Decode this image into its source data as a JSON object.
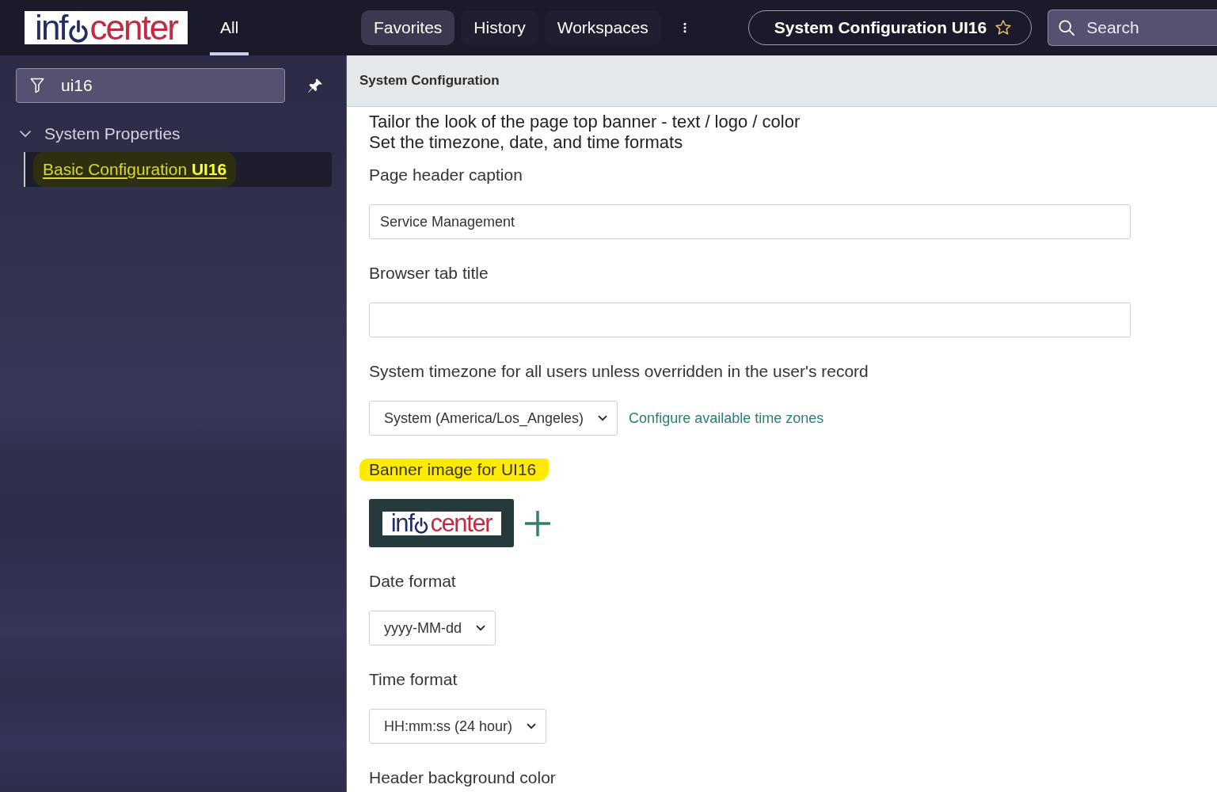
{
  "sidebar": {
    "logo": {
      "text_start": "inf",
      "text_end": "center"
    },
    "tabs": [
      {
        "label": "All",
        "selected": true
      }
    ],
    "filter": {
      "value": "ui16"
    },
    "tree": [
      {
        "label": "System Properties",
        "expanded": true,
        "children": [
          {
            "label": "Basic Configuration **UI16**",
            "selected": true,
            "highlighted": true
          }
        ]
      }
    ]
  },
  "top_bar": {
    "tabs": [
      {
        "label": "Favorites",
        "selected": true
      },
      {
        "label": "History",
        "selected": false
      },
      {
        "label": "Workspaces",
        "selected": false
      }
    ],
    "page_title": "System Configuration UI16",
    "search": {
      "placeholder": "Search"
    }
  },
  "content": {
    "header": "System Configuration",
    "intro": [
      "Tailor the look of the page top banner - text / logo / color",
      "Set the timezone, date, and time formats"
    ],
    "fields": [
      {
        "kind": "text",
        "label": "Page header caption",
        "highlighted": false,
        "value": "Service Management"
      },
      {
        "kind": "text",
        "label": "Browser tab title",
        "highlighted": false
      },
      {
        "kind": "select",
        "label": "System timezone for all users unless overridden in the user's record",
        "highlighted": false,
        "value": "System (America/Los_Angeles)",
        "link": "Configure available time zones"
      },
      {
        "kind": "image",
        "label": "Banner image for UI16",
        "highlighted": true,
        "logo": {
          "text_start": "inf",
          "text_end": "center"
        }
      },
      {
        "kind": "select",
        "label": "Date format",
        "highlighted": false,
        "value": "yyyy-MM-dd"
      },
      {
        "kind": "select",
        "label": "Time format",
        "highlighted": false,
        "value": "HH:mm:ss (24 hour)"
      },
      {
        "kind": "color",
        "label": "Header background color",
        "highlighted": false
      }
    ]
  }
}
